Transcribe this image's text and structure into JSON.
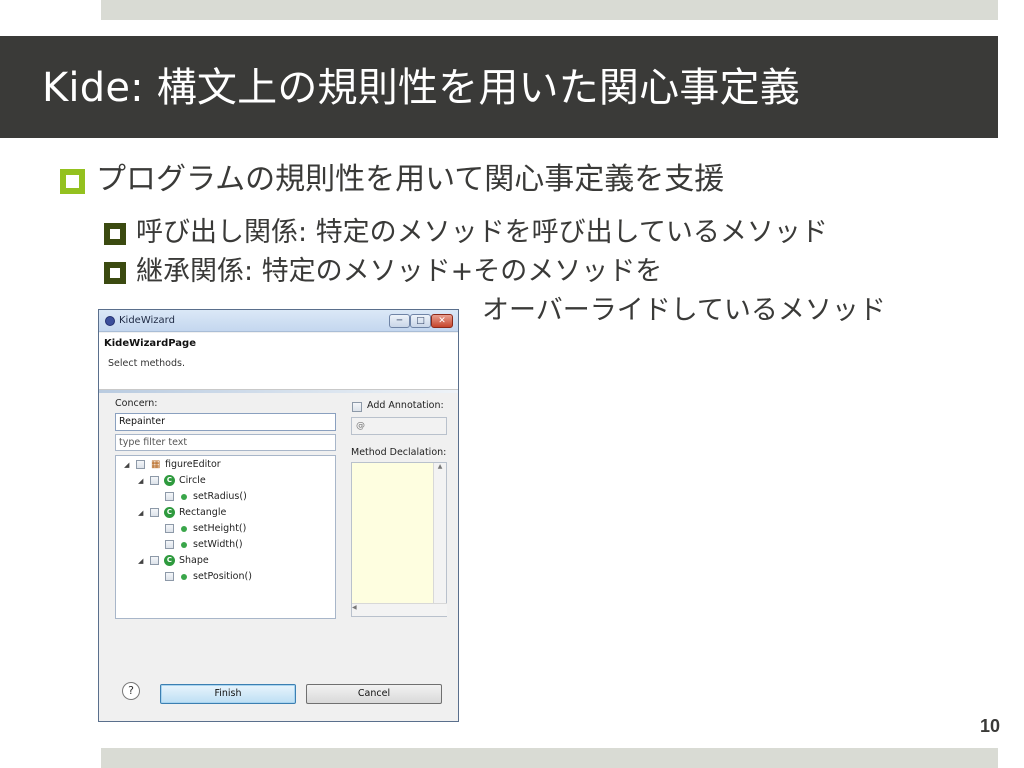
{
  "slide": {
    "title": "Kide: 構文上の規則性を用いた関心事定義",
    "bullet_main": "プログラムの規則性を用いて関心事定義を支援",
    "bullet_sub1": "呼び出し関係: 特定のメソッドを呼び出しているメソッド",
    "bullet_sub2": "継承関係: 特定のメソッド+そのメソッドを",
    "bullet_sub2_cont": "オーバーライドしているメソッド",
    "page_number": "10",
    "colors": {
      "title_bg": "#3a3a38",
      "band": "#d9dbd4",
      "bullet_l1": "#94c11f",
      "bullet_l2": "#3b4a10"
    }
  },
  "dialog": {
    "window_title": "KideWizard",
    "page_title": "KideWizardPage",
    "description": "Select methods.",
    "concern_label": "Concern:",
    "concern_value": "Repainter",
    "filter_placeholder": "type filter text",
    "add_annotation_label": "Add Annotation:",
    "annotation_value": "@",
    "method_decl_label": "Method Declalation:",
    "tree": [
      {
        "label": "figureEditor",
        "kind": "package",
        "expanded": true
      },
      {
        "label": "Circle",
        "kind": "class",
        "expanded": true
      },
      {
        "label": "setRadius()",
        "kind": "method"
      },
      {
        "label": "Rectangle",
        "kind": "class",
        "expanded": true
      },
      {
        "label": "setHeight()",
        "kind": "method"
      },
      {
        "label": "setWidth()",
        "kind": "method"
      },
      {
        "label": "Shape",
        "kind": "class",
        "expanded": true
      },
      {
        "label": "setPosition()",
        "kind": "method"
      }
    ],
    "help_icon": "?",
    "finish_label": "Finish",
    "cancel_label": "Cancel",
    "icons": [
      "eclipse-icon",
      "minimize-icon",
      "maximize-icon",
      "close-icon",
      "package-icon",
      "class-icon",
      "method-icon",
      "help-icon"
    ]
  }
}
